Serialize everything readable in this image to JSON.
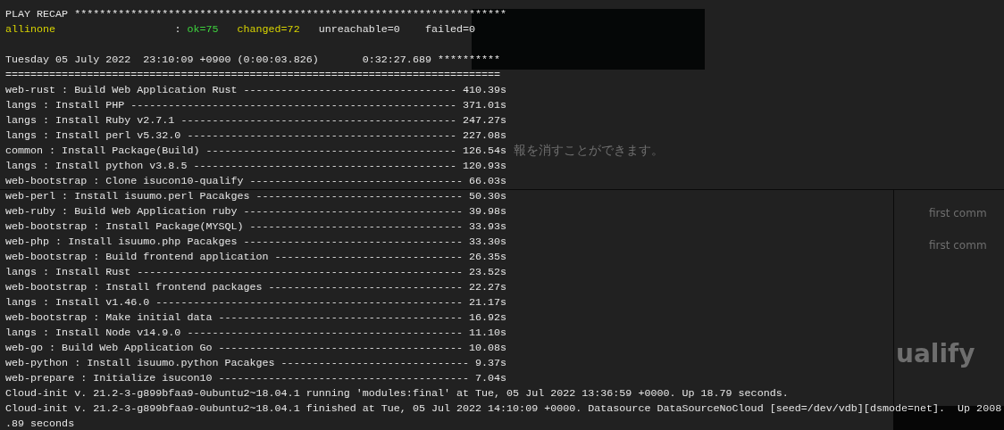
{
  "background_windows": {
    "texts": [
      {
        "kind": "caption",
        "text": "報を消すことができます。"
      },
      {
        "kind": "list-item",
        "text": "first comm"
      },
      {
        "kind": "list-item",
        "text": "first comm"
      },
      {
        "kind": "heading",
        "text": "ualify"
      }
    ]
  },
  "terminal": {
    "lines": [
      {
        "kind": "plain",
        "text": "PLAY RECAP *********************************************************************"
      },
      {
        "kind": "host",
        "segments": [
          {
            "text": "allinone                   ",
            "color": "#d8d400"
          },
          {
            "text": ": "
          },
          {
            "text": "ok=75   ",
            "color": "#3ed23e"
          },
          {
            "text": "changed=72   ",
            "color": "#d8d400"
          },
          {
            "text": "unreachable=0    failed=0",
            "color": "#e6e6e6"
          }
        ]
      },
      {
        "kind": "blank"
      },
      {
        "kind": "plain",
        "text": "Tuesday 05 July 2022  23:10:09 +0900 (0:00:03.826)       0:32:27.689 **********"
      },
      {
        "kind": "plain",
        "text": "==============================================================================="
      },
      {
        "kind": "plain",
        "text": "web-rust : Build Web Application Rust ---------------------------------- 410.39s"
      },
      {
        "kind": "plain",
        "text": "langs : Install PHP ---------------------------------------------------- 371.01s"
      },
      {
        "kind": "plain",
        "text": "langs : Install Ruby v2.7.1 -------------------------------------------- 247.27s"
      },
      {
        "kind": "plain",
        "text": "langs : Install perl v5.32.0 ------------------------------------------- 227.08s"
      },
      {
        "kind": "plain",
        "text": "common : Install Package(Build) ---------------------------------------- 126.54s"
      },
      {
        "kind": "plain",
        "text": "langs : Install python v3.8.5 ------------------------------------------ 120.93s"
      },
      {
        "kind": "plain",
        "text": "web-bootstrap : Clone isucon10-qualify ---------------------------------- 66.03s"
      },
      {
        "kind": "plain",
        "text": "web-perl : Install isuumo.perl Pacakges --------------------------------- 50.30s"
      },
      {
        "kind": "plain",
        "text": "web-ruby : Build Web Application ruby ----------------------------------- 39.98s"
      },
      {
        "kind": "plain",
        "text": "web-bootstrap : Install Package(MYSQL) ---------------------------------- 33.93s"
      },
      {
        "kind": "plain",
        "text": "web-php : Install isuumo.php Pacakges ----------------------------------- 33.30s"
      },
      {
        "kind": "plain",
        "text": "web-bootstrap : Build frontend application ------------------------------ 26.35s"
      },
      {
        "kind": "plain",
        "text": "langs : Install Rust ---------------------------------------------------- 23.52s"
      },
      {
        "kind": "plain",
        "text": "web-bootstrap : Install frontend packages ------------------------------- 22.27s"
      },
      {
        "kind": "plain",
        "text": "langs : Install v1.46.0 ------------------------------------------------- 21.17s"
      },
      {
        "kind": "plain",
        "text": "web-bootstrap : Make initial data --------------------------------------- 16.92s"
      },
      {
        "kind": "plain",
        "text": "langs : Install Node v14.9.0 -------------------------------------------- 11.10s"
      },
      {
        "kind": "plain",
        "text": "web-go : Build Web Application Go --------------------------------------- 10.08s"
      },
      {
        "kind": "plain",
        "text": "web-python : Install isuumo.python Pacakges ------------------------------ 9.37s"
      },
      {
        "kind": "plain",
        "text": "web-prepare : Initialize isucon10 ---------------------------------------- 7.04s"
      },
      {
        "kind": "plain",
        "text": "Cloud-init v. 21.2-3-g899bfaa9-0ubuntu2~18.04.1 running 'modules:final' at Tue, 05 Jul 2022 13:36:59 +0000. Up 18.79 seconds."
      },
      {
        "kind": "plain",
        "text": "Cloud-init v. 21.2-3-g899bfaa9-0ubuntu2~18.04.1 finished at Tue, 05 Jul 2022 14:10:09 +0000. Datasource DataSourceNoCloud [seed=/dev/vdb][dsmode=net].  Up 2008"
      },
      {
        "kind": "plain",
        "text": ".89 seconds"
      }
    ]
  }
}
